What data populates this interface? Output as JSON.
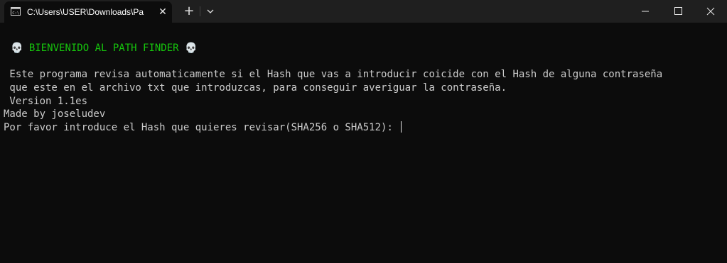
{
  "window": {
    "tab_title": "C:\\Users\\USER\\Downloads\\Pa",
    "tab_icon": "cmd-terminal-icon",
    "close_tab": "✕",
    "new_tab": "+",
    "controls": [
      "minimize-icon",
      "maximize-icon",
      "close-icon"
    ]
  },
  "console": {
    "banner_skull": "💀",
    "banner_text": "BIENVENIDO AL PATH FINDER",
    "description_line1": " Este programa revisa automaticamente si el Hash que vas a introducir coicide con el Hash de alguna contraseña",
    "description_line2": " que este en el archivo txt que introduzcas, para conseguir averiguar la contraseña.",
    "version": " Version 1.1es",
    "author": "Made by joseludev",
    "prompt": "Por favor introduce el Hash que quieres revisar(SHA256 o SHA512): "
  },
  "colors": {
    "background": "#0c0c0c",
    "text": "#cccccc",
    "banner": "#16c60c",
    "titlebar": "#1f1f1f"
  }
}
